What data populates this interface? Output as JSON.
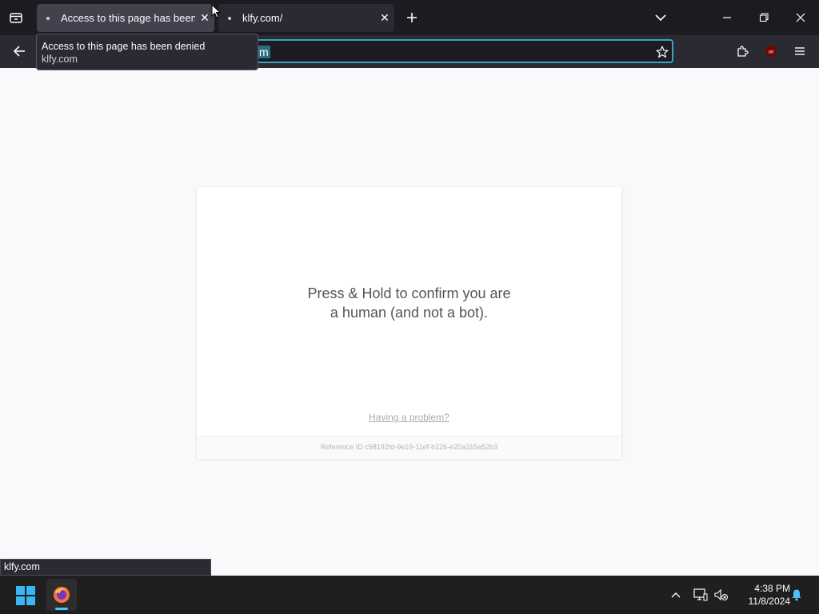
{
  "browser": {
    "tabs": [
      {
        "label": "Access to this page has been de",
        "active": true
      },
      {
        "label": "klfy.com/",
        "active": false
      }
    ],
    "close_glyph": "✕",
    "urlbar": {
      "visible_text": "m"
    },
    "tooltip": {
      "title": "Access to this page has been denied",
      "url": "klfy.com"
    },
    "status_url": "klfy.com"
  },
  "page": {
    "message_line1": "Press & Hold to confirm you are",
    "message_line2": "a human (and not a bot).",
    "problem_link": "Having a problem?",
    "reference": "Reference ID c58192fd-9e19-11ef-b226-e20a315a52b3"
  },
  "taskbar": {
    "time": "4:38 PM",
    "date": "11/8/2024"
  },
  "colors": {
    "accent": "#38a3be",
    "tab_active": "#42414d",
    "chrome_dark": "#1c1b22",
    "toolbar": "#2b2a33",
    "windows_blue": "#38b6f5"
  },
  "icons": [
    "tab-list-icon",
    "close-icon",
    "new-tab-icon",
    "tab-overflow-icon",
    "minimize-icon",
    "restore-icon",
    "back-icon",
    "bookmark-star-icon",
    "extensions-icon",
    "ublock-icon",
    "menu-icon",
    "windows-start-icon",
    "firefox-icon",
    "tray-chevron-icon",
    "network-icon",
    "volume-muted-icon",
    "notification-bell-icon"
  ]
}
